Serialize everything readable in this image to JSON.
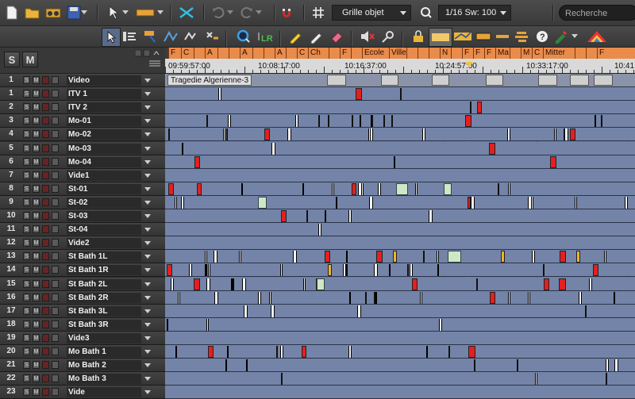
{
  "toolbar": {
    "grid_mode": "Grille objet",
    "snap_value": "1/16 Sw: 100",
    "search_placeholder": "Recherche"
  },
  "header": {
    "solo_label": "S",
    "mute_label": "M"
  },
  "ruler": {
    "timecodes": [
      "09:59:57:00",
      "10:08:17:00",
      "10:16:37:00",
      "10:24:57:00",
      "10:33:17:00",
      "10:41"
    ],
    "markers": [
      "F",
      "C",
      "",
      "A",
      "",
      "",
      "A",
      "",
      "",
      "A",
      "",
      "C",
      "Ch",
      "",
      "F",
      "",
      "Ecole",
      "Ville",
      "",
      "",
      "",
      "N",
      "",
      "F",
      "F",
      "F",
      "Ma",
      "",
      "M",
      "C",
      "Mitter",
      "",
      "",
      "F"
    ]
  },
  "timeline": {
    "clip_title": "Tragedie Algerienne-3"
  },
  "tracks": [
    {
      "num": "1",
      "name": "Video"
    },
    {
      "num": "1",
      "name": "ITV 1"
    },
    {
      "num": "2",
      "name": "ITV 2"
    },
    {
      "num": "3",
      "name": "Mo-01"
    },
    {
      "num": "4",
      "name": "Mo-02"
    },
    {
      "num": "5",
      "name": "Mo-03"
    },
    {
      "num": "6",
      "name": "Mo-04"
    },
    {
      "num": "7",
      "name": "Vide1"
    },
    {
      "num": "8",
      "name": "St-01"
    },
    {
      "num": "9",
      "name": "St-02"
    },
    {
      "num": "10",
      "name": "St-03"
    },
    {
      "num": "11",
      "name": "St-04"
    },
    {
      "num": "12",
      "name": "Vide2"
    },
    {
      "num": "13",
      "name": "St Bath 1L"
    },
    {
      "num": "14",
      "name": "St Bath 1R"
    },
    {
      "num": "15",
      "name": "St Bath 2L"
    },
    {
      "num": "16",
      "name": "St Bath 2R"
    },
    {
      "num": "17",
      "name": "St Bath 3L"
    },
    {
      "num": "18",
      "name": "St Bath 3R"
    },
    {
      "num": "19",
      "name": "Vide3"
    },
    {
      "num": "20",
      "name": "Mo Bath 1"
    },
    {
      "num": "21",
      "name": "Mo Bath 2"
    },
    {
      "num": "22",
      "name": "Mo Bath 3"
    },
    {
      "num": "23",
      "name": "Vide"
    }
  ],
  "track_button_labels": {
    "solo": "S",
    "mute": "M"
  },
  "colors": {
    "timeline_bg": "#7484a8",
    "marker_bar": "#e98b4b",
    "clip_red": "#e41f1f",
    "clip_green": "#cde8c6",
    "clip_yellow": "#f0b42a"
  }
}
